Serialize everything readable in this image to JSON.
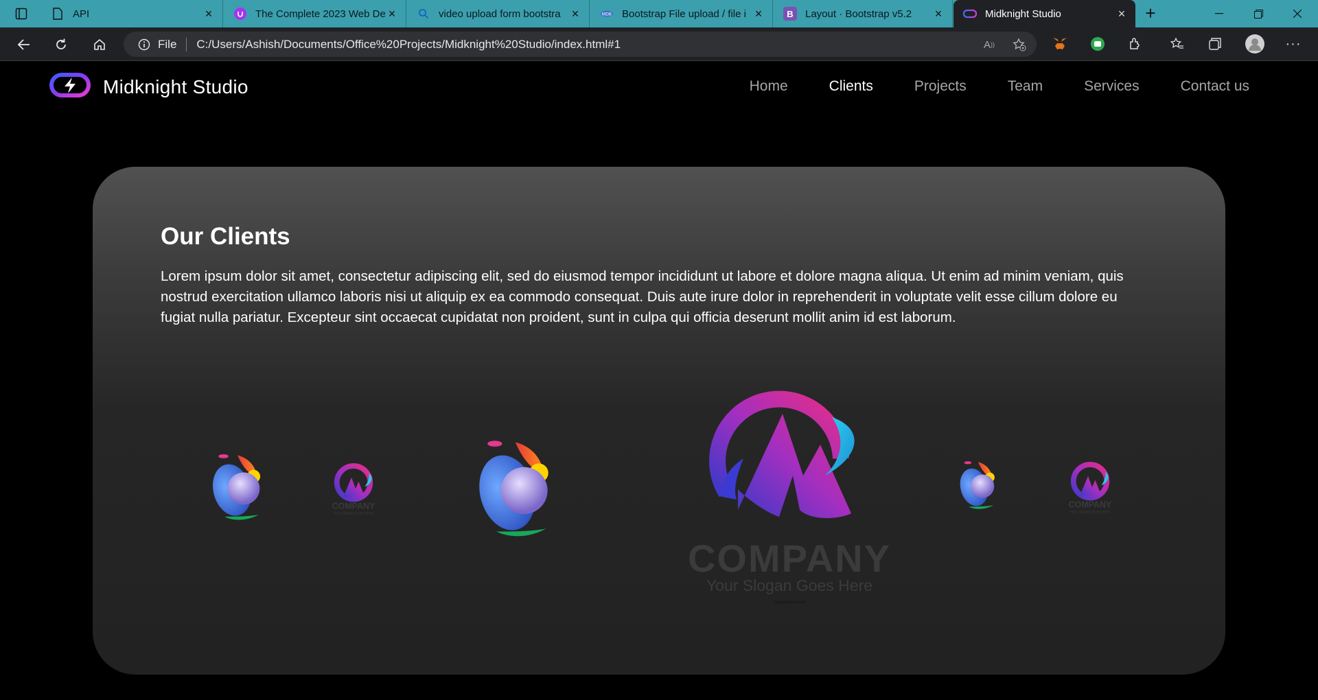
{
  "browser": {
    "tabs": [
      {
        "title": "API",
        "icon": "page-icon"
      },
      {
        "title": "The Complete 2023 Web De",
        "icon": "udemy-icon"
      },
      {
        "title": "video upload form bootstra",
        "icon": "search-icon"
      },
      {
        "title": "Bootstrap File upload / file i",
        "icon": "mdb-icon"
      },
      {
        "title": "Layout · Bootstrap v5.2",
        "icon": "bootstrap-icon"
      },
      {
        "title": "Midknight Studio",
        "icon": "midknight-icon"
      }
    ],
    "address": {
      "scheme": "File",
      "url": "C:/Users/Ashish/Documents/Office%20Projects/Midknight%20Studio/index.html#1"
    },
    "colors": {
      "tabbar": "#3b9fae",
      "toolbar": "#202124"
    }
  },
  "site": {
    "brand": "Midknight Studio",
    "nav": [
      "Home",
      "Clients",
      "Projects",
      "Team",
      "Services",
      "Contact us"
    ],
    "active_nav": "Clients",
    "clients": {
      "title": "Our Clients",
      "text": "Lorem ipsum dolor sit amet, consectetur adipiscing elit, sed do eiusmod tempor incididunt ut labore et dolore magna aliqua. Ut enim ad minim veniam, quis nostrud exercitation ullamco laboris nisi ut aliquip ex ea commodo consequat. Duis aute irure dolor in reprehenderit in voluptate velit esse cillum dolore eu fugiat nulla pariatur. Excepteur sint occaecat cupidatat non proident, sunt in culpa qui officia deserunt mollit anim id est laborum.",
      "company_logo": {
        "name": "COMPANY",
        "slogan": "Your Slogan Goes Here",
        "designer": "Designed by Freepik"
      }
    }
  }
}
